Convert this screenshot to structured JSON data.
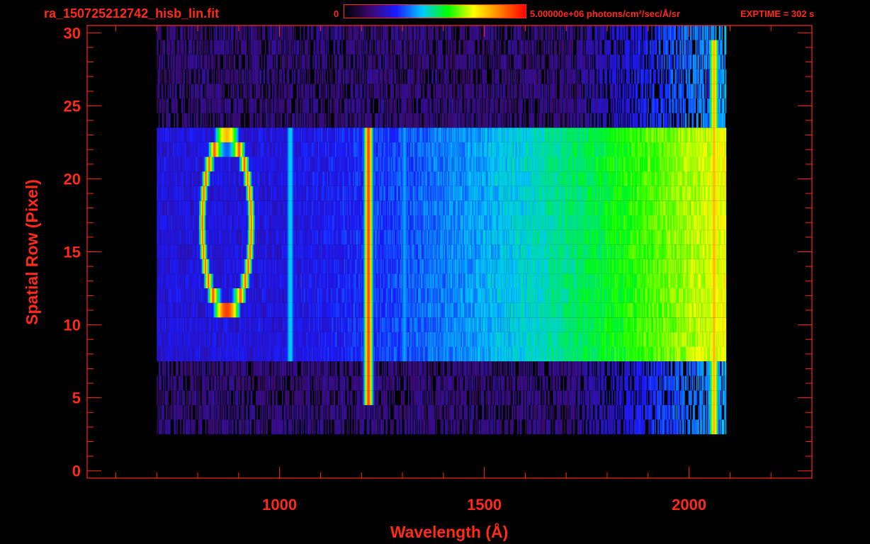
{
  "header": {
    "file_title": "ra_150725212742_hisb_lin.fit",
    "colorbar_min_label": "0",
    "colorbar_max_label": "5.00000e+06 photons/cm²/sec/Å/sr",
    "exposure_label": "EXPTIME = 302 s"
  },
  "colors": {
    "axis": "#ff2a1a",
    "background": "#000000",
    "colormap": [
      "#000000",
      "#3a0a6e",
      "#1a1aff",
      "#00c8ff",
      "#00ff00",
      "#ffff00",
      "#ff8000",
      "#ff0000"
    ]
  },
  "chart_data": {
    "type": "heatmap",
    "title": "ra_150725212742_hisb_lin.fit",
    "xlabel": "Wavelength (Å)",
    "ylabel": "Spatial Row (Pixel)",
    "xlim": [
      530,
      2300
    ],
    "ylim": [
      -0.5,
      30.5
    ],
    "x_ticks": [
      1000,
      1500,
      2000
    ],
    "y_ticks": [
      0,
      5,
      10,
      15,
      20,
      25,
      30
    ],
    "colorbar": {
      "min": 0,
      "max": 5000000,
      "units": "photons/cm²/sec/Å/sr",
      "scale": "linear"
    },
    "exposure_time_s": 302,
    "data_extent": {
      "wavelength": [
        700,
        2090
      ],
      "rows": [
        3,
        30
      ]
    },
    "bright_row_band": [
      8,
      23
    ],
    "features": [
      {
        "wavelength": 1216,
        "rows": [
          5,
          23
        ],
        "level": 0.92
      },
      {
        "wavelength": 1025,
        "rows": [
          8,
          23
        ],
        "level": 0.45
      },
      {
        "wavelength": 1304,
        "rows": [
          8,
          23
        ],
        "level": 0.4
      },
      {
        "wavelength": 2060,
        "rows": [
          0,
          29
        ],
        "level": 0.8
      }
    ],
    "ring_feature": {
      "center_wavelength": 870,
      "center_row": 16.9,
      "half_width": 60,
      "half_height": 5.9,
      "peak_level": 0.78
    },
    "grid": false
  }
}
